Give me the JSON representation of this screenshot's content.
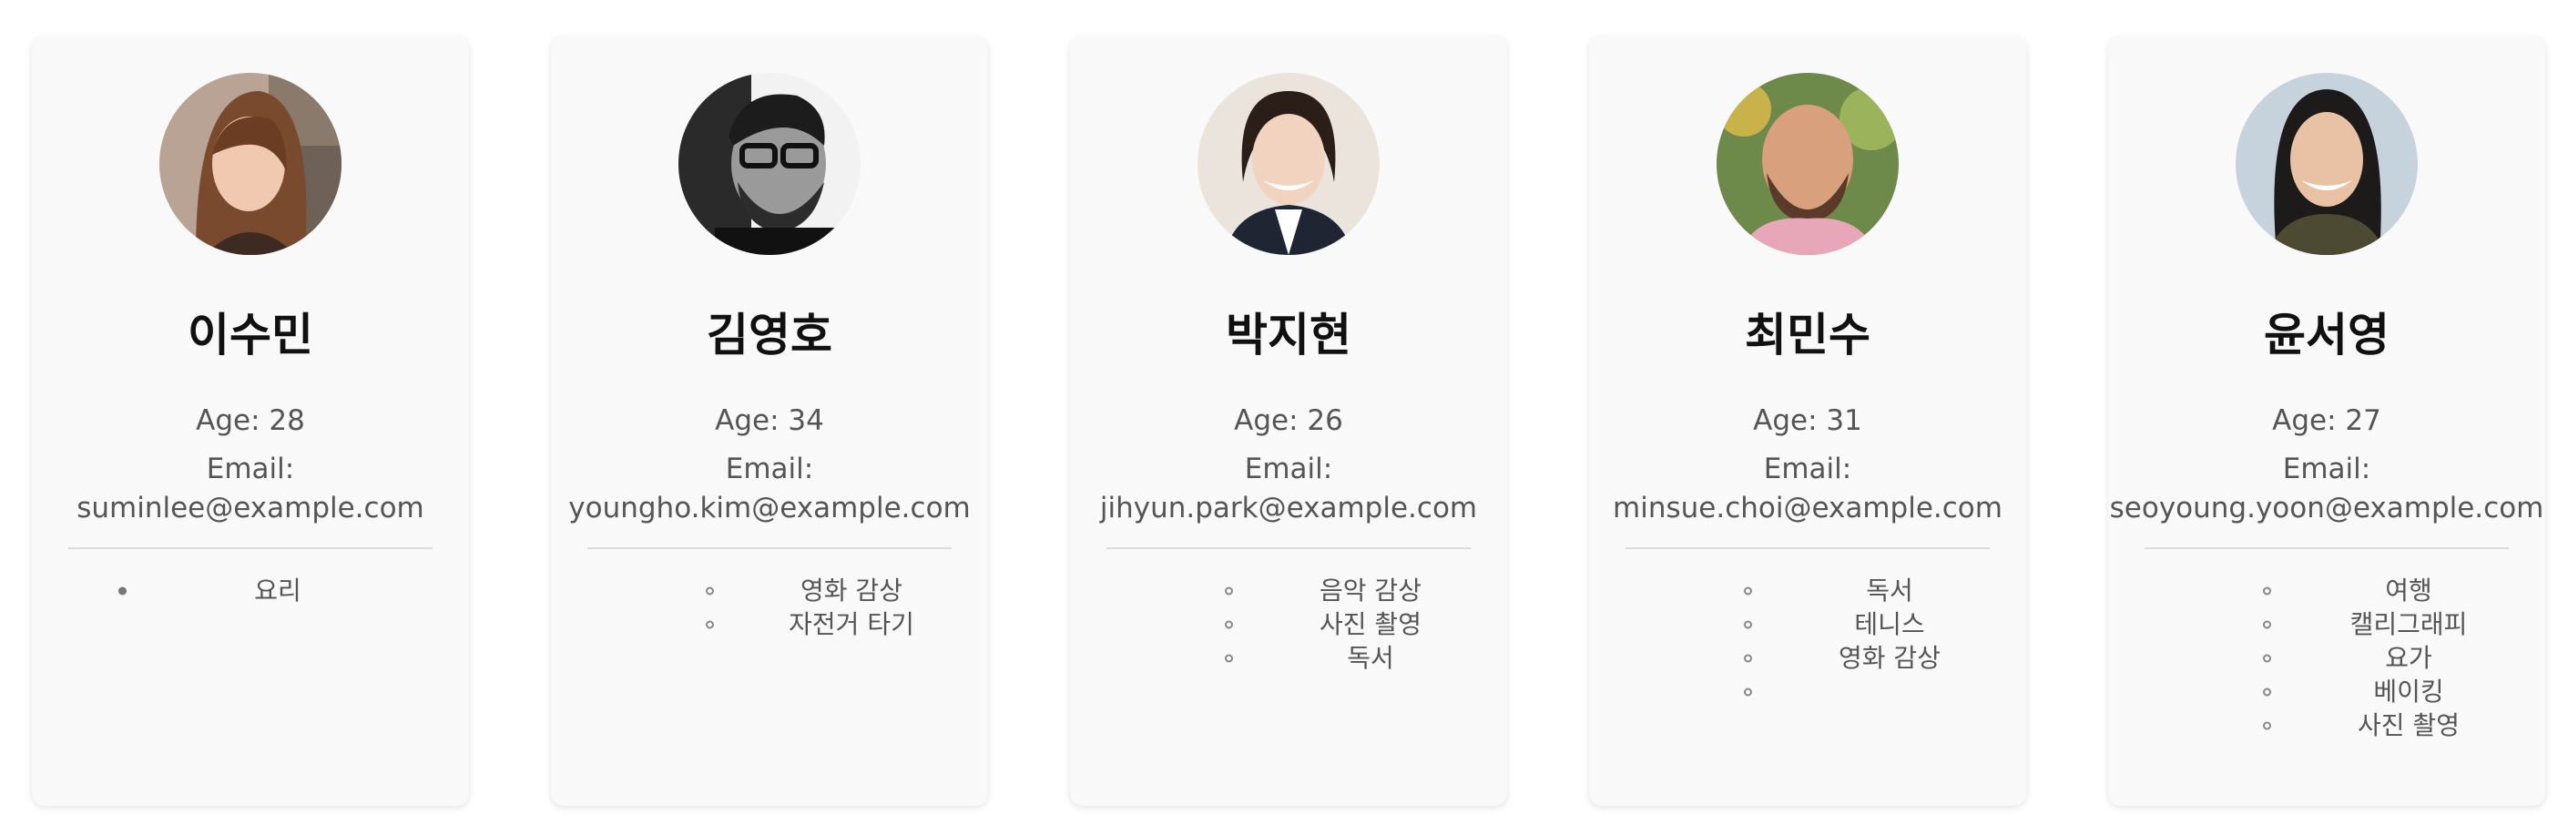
{
  "profiles": [
    {
      "name": "이수민",
      "age": "Age: 28",
      "email_label": "Email:",
      "email": "suminlee@example.com",
      "avatar": "photo-woman-long-hair",
      "list_style": "disc",
      "hobbies": [
        "요리"
      ]
    },
    {
      "name": "김영호",
      "age": "Age: 34",
      "email_label": "Email:",
      "email": "youngho.kim@example.com",
      "avatar": "photo-man-glasses-bw",
      "list_style": "circle",
      "hobbies": [
        "영화 감상",
        "자전거 타기"
      ]
    },
    {
      "name": "박지현",
      "age": "Age: 26",
      "email_label": "Email:",
      "email": "jihyun.park@example.com",
      "avatar": "photo-woman-blazer",
      "list_style": "circle",
      "hobbies": [
        "음악 감상",
        "사진 촬영",
        "독서"
      ]
    },
    {
      "name": "최민수",
      "age": "Age: 31",
      "email_label": "Email:",
      "email": "minsue.choi@example.com",
      "avatar": "photo-man-bald-beard",
      "list_style": "circle",
      "hobbies": [
        "독서",
        "테니스",
        "영화 감상",
        ""
      ]
    },
    {
      "name": "윤서영",
      "age": "Age: 27",
      "email_label": "Email:",
      "email": "seoyoung.yoon@example.com",
      "avatar": "photo-woman-smiling",
      "list_style": "circle",
      "hobbies": [
        "여행",
        "캘리그래피",
        "요가",
        "베이킹",
        "사진 촬영"
      ]
    }
  ]
}
